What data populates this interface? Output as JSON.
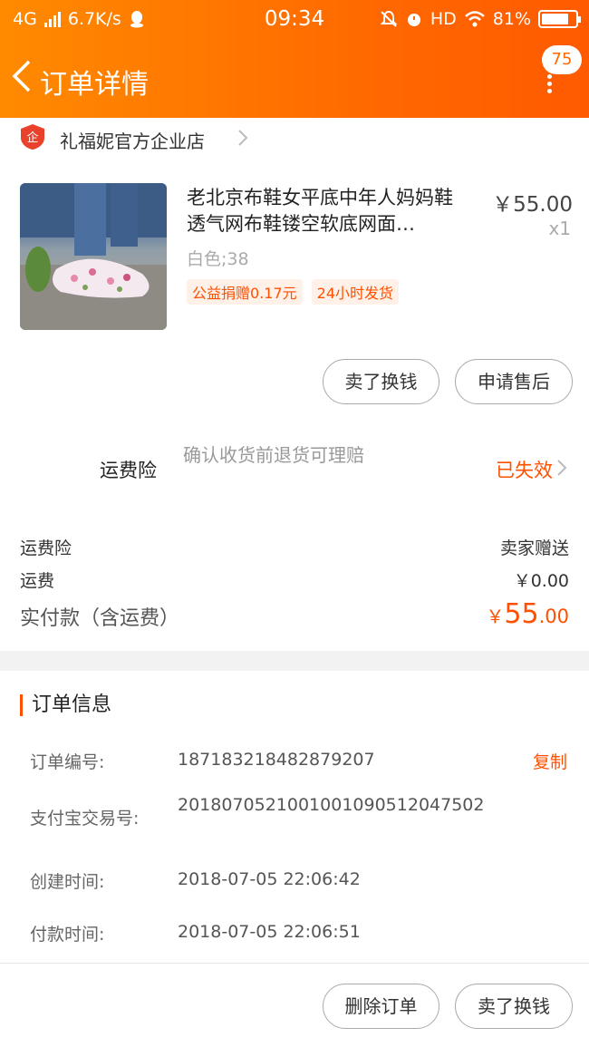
{
  "status_bar": {
    "network": "4G",
    "speed": "6.7K/s",
    "time": "09:34",
    "hd": "HD",
    "battery": "81%",
    "battery_level": 0.81
  },
  "nav": {
    "title": "订单详情",
    "badge": "75"
  },
  "shop": {
    "name": "礼福妮官方企业店"
  },
  "product": {
    "title": "老北京布鞋女平底中年人妈妈鞋透气网布鞋镂空软底网面…",
    "price": "￥55.00",
    "qty": "x1",
    "sku": "白色;38",
    "tags": [
      "公益捐赠0.17元",
      "24小时发货"
    ]
  },
  "actions": {
    "sell_label": "卖了换钱",
    "after_sale_label": "申请售后"
  },
  "insurance": {
    "label": "运费险",
    "desc": "确认收货前退货可理赔",
    "status": "已失效"
  },
  "fees": {
    "ins_label": "运费险",
    "ins_value": "卖家赠送",
    "ship_label": "运费",
    "ship_value": "￥0.00",
    "total_label": "实付款（含运费）",
    "total_currency": "￥",
    "total_int": "55",
    "total_dec": ".00"
  },
  "order_info": {
    "heading": "订单信息",
    "copy_label": "复制",
    "rows": [
      {
        "label": "订单编号:",
        "value": "187183218482879207"
      },
      {
        "label": "支付宝交易号:",
        "value": "2018070521001001090512047502"
      },
      {
        "label": "创建时间:",
        "value": "2018-07-05 22:06:42"
      },
      {
        "label": "付款时间:",
        "value": "2018-07-05 22:06:51"
      }
    ]
  },
  "bottom": {
    "delete_label": "删除订单",
    "sell_label": "卖了换钱"
  },
  "colors": {
    "accent": "#ff5000",
    "header_start": "#ff8a00",
    "header_end": "#ff5a00"
  }
}
